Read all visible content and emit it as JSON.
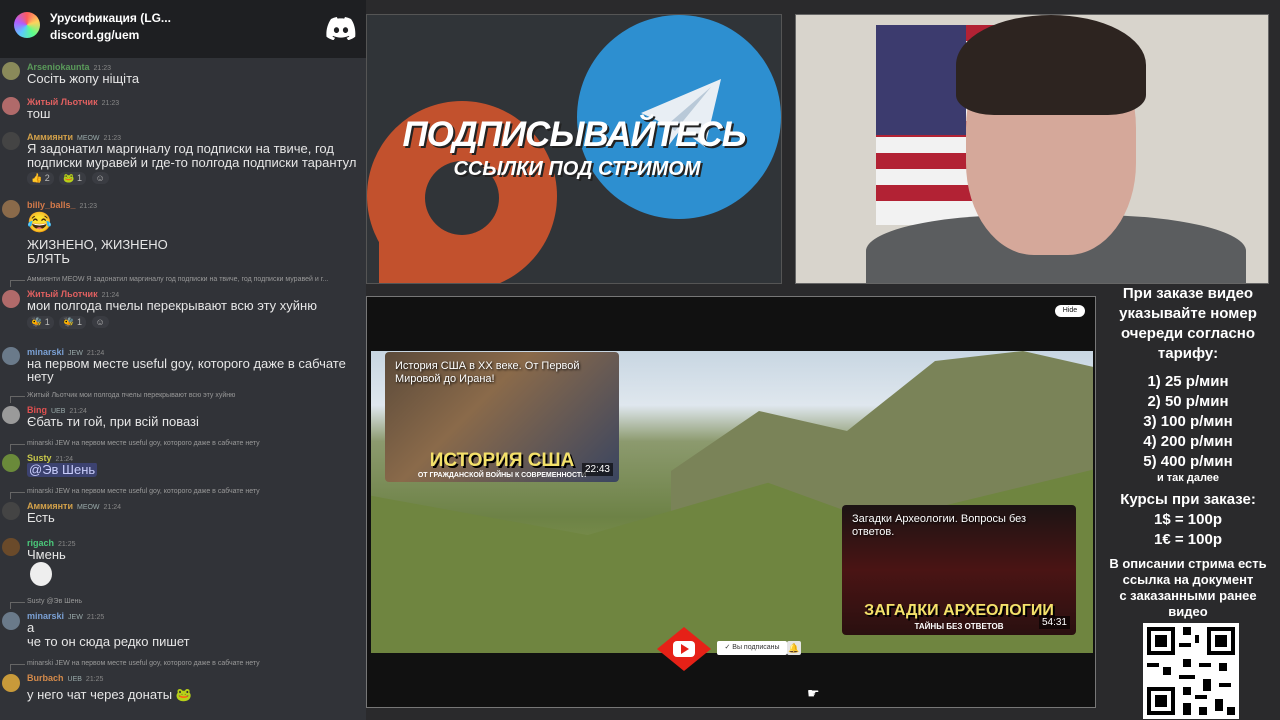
{
  "chat": {
    "server_name": "Урусификация (LG...",
    "server_link": "discord.gg/uem",
    "messages": [
      {
        "author": "Arseniokaunta",
        "time": "21:23",
        "text": "Сосіть жопу ніщіта",
        "color": "#5a9a5a"
      },
      {
        "author": "Житый Льотчик",
        "time": "21:23",
        "text": "тош",
        "color": "#e06060"
      },
      {
        "author": "Аммиянти",
        "tag": "MEOW",
        "time": "21:23",
        "text": "Я задонатил маргиналу год подписки на твиче, год",
        "text2": "подписки муравей и где-то полгода подписки тарантул",
        "reacts": [
          "2",
          "1"
        ],
        "color": "#d4a24a"
      },
      {
        "author": "billy_balls_",
        "time": "21:23",
        "text": "ЖИЗНЕНО, ЖИЗНЕНО",
        "text2": "БЛЯТЬ",
        "color": "#d47a4a"
      },
      {
        "reply": "Аммиянти MEOW Я задонатил маргиналу год подписки на твиче, год подписки муравей и г...",
        "author": "Житый Льотчик",
        "time": "21:24",
        "text": "мои полгода пчелы перекрывают всю эту хуйню",
        "reacts": [
          "1",
          "1"
        ],
        "color": "#e06060"
      },
      {
        "author": "minarski",
        "tag": "JEW",
        "time": "21:24",
        "text": "на первом месте useful goy, которого даже в сабчате",
        "text2": "нету",
        "color": "#7aa0d4"
      },
      {
        "reply": "Житый Льотчик мои полгода пчелы перекрывают всю эту хуйню",
        "author": "Bing",
        "tag": "UEB",
        "time": "21:24",
        "text": "Єбать ти гой, при всій повазі",
        "color": "#e05050"
      },
      {
        "reply": "minarski JEW на первом месте useful goy, которого даже в сабчате нету",
        "author": "Susty",
        "time": "21:24",
        "text": "@Эв Шень",
        "color": "#c8c84a"
      },
      {
        "reply": "minarski JEW на первом месте useful goy, которого даже в сабчате нету",
        "author": "Аммиянти",
        "tag": "MEOW",
        "time": "21:24",
        "text": "Есть",
        "color": "#d4a24a"
      },
      {
        "author": "rigach",
        "time": "21:25",
        "text": "Чмень",
        "color": "#4ac87a"
      },
      {
        "reply": "Susty @Эв Шень",
        "author": "minarski",
        "tag": "JEW",
        "time": "21:25",
        "text": "а",
        "text2": "че то он сюда редко пишет",
        "color": "#7aa0d4"
      },
      {
        "reply": "minarski JEW на первом месте useful goy, которого даже в сабчате нету",
        "author": "Burbach",
        "tag": "UEB",
        "time": "21:25",
        "text": "у него чат через донаты",
        "color": "#d48a4a"
      }
    ]
  },
  "banner": {
    "title": "ПОДПИСЫВАЙТЕСЬ",
    "subtitle": "ССЫЛКИ ПОД СТРИМОМ"
  },
  "video": {
    "hide_label": "Hide",
    "card1": {
      "title": "История США в XX веке. От Первой Мировой до Ирана!",
      "big": "ИСТОРИЯ США",
      "small": "ОТ ГРАЖДАНСКОЙ ВОЙНЫ К СОВРЕМЕННОСТИ",
      "duration": "22:43"
    },
    "card2": {
      "title": "Загадки Археологии. Вопросы без ответов.",
      "big": "ЗАГАДКИ АРХЕОЛОГИИ",
      "small": "ТАЙНЫ БЕЗ ОТВЕТОВ",
      "duration": "54:31"
    },
    "subscribed_label": "Вы подписаны"
  },
  "prices": {
    "heading": [
      "При заказе видео",
      "указывайте номер",
      "очереди согласно",
      "тарифу:"
    ],
    "tiers": [
      "1) 25 р/мин",
      "2) 50 р/мин",
      "3) 100 р/мин",
      "4) 200 р/мин",
      "5) 400 р/мин"
    ],
    "etc": "и так далее",
    "rates_heading": "Курсы при заказе:",
    "rates": [
      "1$ = 100р",
      "1€ = 100р"
    ],
    "note": [
      "В описании стрима есть",
      "ссылка на документ",
      "с заказанными ранее",
      "видео"
    ]
  },
  "colors": {
    "telegram": "#2d8fd0",
    "patreon": "#c2512d",
    "youtube": "#e62117"
  }
}
